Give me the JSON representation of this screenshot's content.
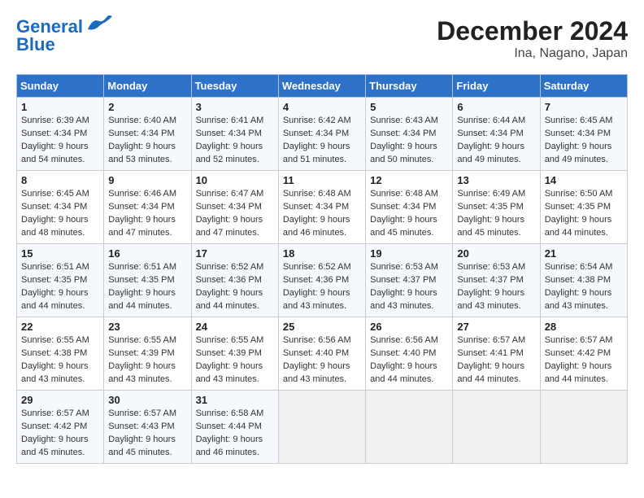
{
  "header": {
    "logo_line1": "General",
    "logo_line2": "Blue",
    "title": "December 2024",
    "subtitle": "Ina, Nagano, Japan"
  },
  "days_of_week": [
    "Sunday",
    "Monday",
    "Tuesday",
    "Wednesday",
    "Thursday",
    "Friday",
    "Saturday"
  ],
  "weeks": [
    [
      {
        "day": "1",
        "sunrise": "6:39 AM",
        "sunset": "4:34 PM",
        "daylight": "9 hours and 54 minutes."
      },
      {
        "day": "2",
        "sunrise": "6:40 AM",
        "sunset": "4:34 PM",
        "daylight": "9 hours and 53 minutes."
      },
      {
        "day": "3",
        "sunrise": "6:41 AM",
        "sunset": "4:34 PM",
        "daylight": "9 hours and 52 minutes."
      },
      {
        "day": "4",
        "sunrise": "6:42 AM",
        "sunset": "4:34 PM",
        "daylight": "9 hours and 51 minutes."
      },
      {
        "day": "5",
        "sunrise": "6:43 AM",
        "sunset": "4:34 PM",
        "daylight": "9 hours and 50 minutes."
      },
      {
        "day": "6",
        "sunrise": "6:44 AM",
        "sunset": "4:34 PM",
        "daylight": "9 hours and 49 minutes."
      },
      {
        "day": "7",
        "sunrise": "6:45 AM",
        "sunset": "4:34 PM",
        "daylight": "9 hours and 49 minutes."
      }
    ],
    [
      {
        "day": "8",
        "sunrise": "6:45 AM",
        "sunset": "4:34 PM",
        "daylight": "9 hours and 48 minutes."
      },
      {
        "day": "9",
        "sunrise": "6:46 AM",
        "sunset": "4:34 PM",
        "daylight": "9 hours and 47 minutes."
      },
      {
        "day": "10",
        "sunrise": "6:47 AM",
        "sunset": "4:34 PM",
        "daylight": "9 hours and 47 minutes."
      },
      {
        "day": "11",
        "sunrise": "6:48 AM",
        "sunset": "4:34 PM",
        "daylight": "9 hours and 46 minutes."
      },
      {
        "day": "12",
        "sunrise": "6:48 AM",
        "sunset": "4:34 PM",
        "daylight": "9 hours and 45 minutes."
      },
      {
        "day": "13",
        "sunrise": "6:49 AM",
        "sunset": "4:35 PM",
        "daylight": "9 hours and 45 minutes."
      },
      {
        "day": "14",
        "sunrise": "6:50 AM",
        "sunset": "4:35 PM",
        "daylight": "9 hours and 44 minutes."
      }
    ],
    [
      {
        "day": "15",
        "sunrise": "6:51 AM",
        "sunset": "4:35 PM",
        "daylight": "9 hours and 44 minutes."
      },
      {
        "day": "16",
        "sunrise": "6:51 AM",
        "sunset": "4:35 PM",
        "daylight": "9 hours and 44 minutes."
      },
      {
        "day": "17",
        "sunrise": "6:52 AM",
        "sunset": "4:36 PM",
        "daylight": "9 hours and 44 minutes."
      },
      {
        "day": "18",
        "sunrise": "6:52 AM",
        "sunset": "4:36 PM",
        "daylight": "9 hours and 43 minutes."
      },
      {
        "day": "19",
        "sunrise": "6:53 AM",
        "sunset": "4:37 PM",
        "daylight": "9 hours and 43 minutes."
      },
      {
        "day": "20",
        "sunrise": "6:53 AM",
        "sunset": "4:37 PM",
        "daylight": "9 hours and 43 minutes."
      },
      {
        "day": "21",
        "sunrise": "6:54 AM",
        "sunset": "4:38 PM",
        "daylight": "9 hours and 43 minutes."
      }
    ],
    [
      {
        "day": "22",
        "sunrise": "6:55 AM",
        "sunset": "4:38 PM",
        "daylight": "9 hours and 43 minutes."
      },
      {
        "day": "23",
        "sunrise": "6:55 AM",
        "sunset": "4:39 PM",
        "daylight": "9 hours and 43 minutes."
      },
      {
        "day": "24",
        "sunrise": "6:55 AM",
        "sunset": "4:39 PM",
        "daylight": "9 hours and 43 minutes."
      },
      {
        "day": "25",
        "sunrise": "6:56 AM",
        "sunset": "4:40 PM",
        "daylight": "9 hours and 43 minutes."
      },
      {
        "day": "26",
        "sunrise": "6:56 AM",
        "sunset": "4:40 PM",
        "daylight": "9 hours and 44 minutes."
      },
      {
        "day": "27",
        "sunrise": "6:57 AM",
        "sunset": "4:41 PM",
        "daylight": "9 hours and 44 minutes."
      },
      {
        "day": "28",
        "sunrise": "6:57 AM",
        "sunset": "4:42 PM",
        "daylight": "9 hours and 44 minutes."
      }
    ],
    [
      {
        "day": "29",
        "sunrise": "6:57 AM",
        "sunset": "4:42 PM",
        "daylight": "9 hours and 45 minutes."
      },
      {
        "day": "30",
        "sunrise": "6:57 AM",
        "sunset": "4:43 PM",
        "daylight": "9 hours and 45 minutes."
      },
      {
        "day": "31",
        "sunrise": "6:58 AM",
        "sunset": "4:44 PM",
        "daylight": "9 hours and 46 minutes."
      },
      null,
      null,
      null,
      null
    ]
  ]
}
